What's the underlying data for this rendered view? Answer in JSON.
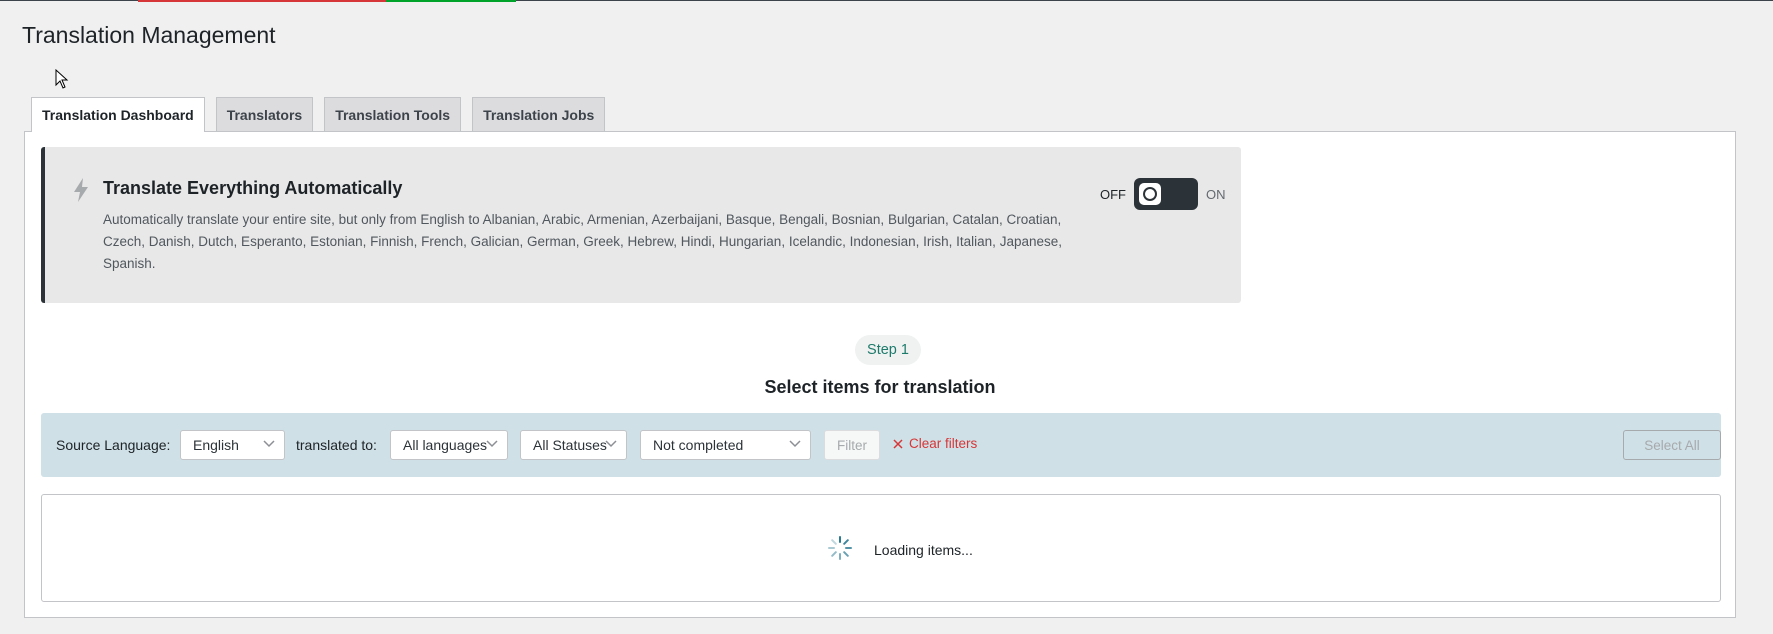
{
  "page": {
    "title": "Translation Management"
  },
  "tabs": [
    {
      "label": "Translation Dashboard",
      "active": true
    },
    {
      "label": "Translators",
      "active": false
    },
    {
      "label": "Translation Tools",
      "active": false
    },
    {
      "label": "Translation Jobs",
      "active": false
    }
  ],
  "auto_translate": {
    "icon": "bolt-icon",
    "title": "Translate Everything Automatically",
    "description": "Automatically translate your entire site, but only from English to Albanian, Arabic, Armenian, Azerbaijani, Basque, Bengali, Bosnian, Bulgarian, Catalan, Croatian, Czech, Danish, Dutch, Esperanto, Estonian, Finnish, French, Galician, German, Greek, Hebrew, Hindi, Hungarian, Icelandic, Indonesian, Irish, Italian, Japanese, Spanish.",
    "toggle_off_label": "OFF",
    "toggle_on_label": "ON",
    "toggle_state": "off"
  },
  "step": {
    "badge": "Step 1",
    "heading": "Select items for translation"
  },
  "filters": {
    "source_language_label": "Source Language:",
    "source_language_value": "English",
    "translated_to_label": "translated to:",
    "target_language_value": "All languages",
    "status_value": "All Statuses",
    "completion_value": "Not completed",
    "filter_button": "Filter",
    "clear_filters": "Clear filters",
    "select_all_button": "Select All"
  },
  "loading": {
    "text": "Loading items..."
  },
  "colors": {
    "accent_teal": "#1e7b6b",
    "danger": "#d63638",
    "filter_bar_bg": "#cfe0e6",
    "dark": "#2c3338"
  }
}
